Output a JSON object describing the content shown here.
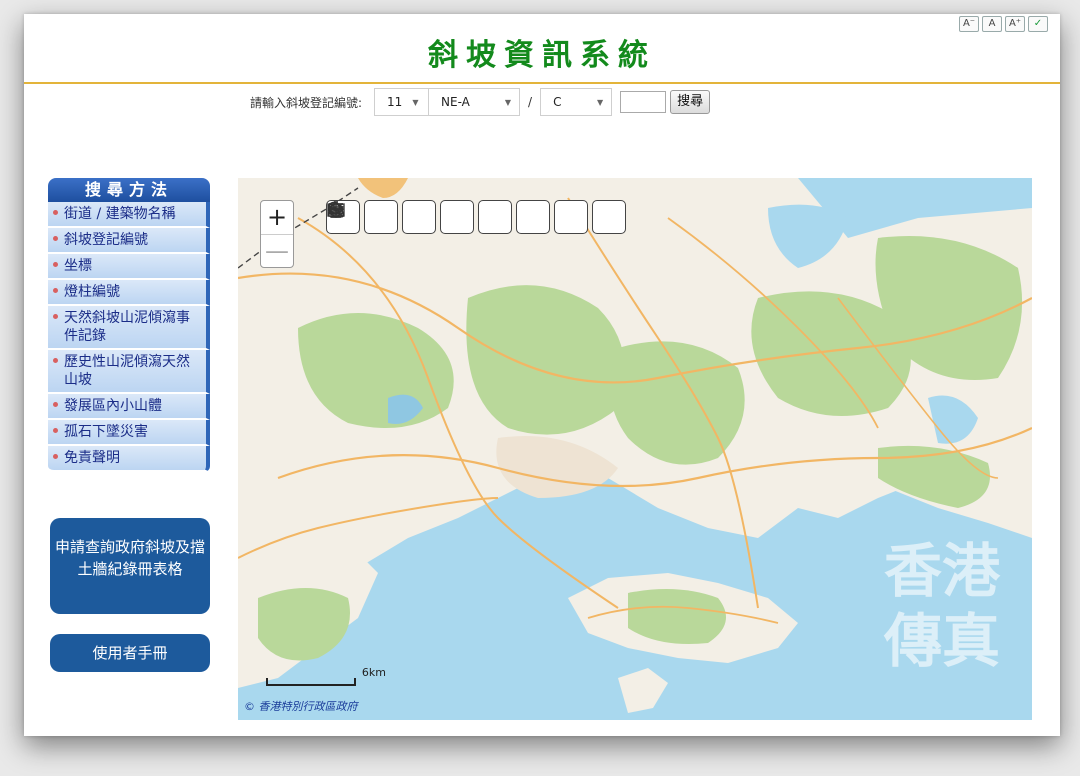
{
  "header": {
    "title": "斜坡資訊系統",
    "font_controls": [
      "A⁻",
      "A",
      "A⁺",
      "✓"
    ]
  },
  "search": {
    "label": "請輸入斜坡登記編號:",
    "sheet_no": "11",
    "subsheet": "NE-A",
    "separator": "/",
    "category": "C",
    "number_value": "",
    "button": "搜尋"
  },
  "sidebar": {
    "heading": "搜尋方法",
    "items": [
      {
        "label": "街道 / 建築物名稱"
      },
      {
        "label": "斜坡登記編號"
      },
      {
        "label": "坐標"
      },
      {
        "label": "燈柱編號"
      },
      {
        "label": "天然斜坡山泥傾瀉事件記錄"
      },
      {
        "label": "歷史性山泥傾瀉天然山坡"
      },
      {
        "label": "發展區內小山體"
      },
      {
        "label": "孤石下墜災害"
      },
      {
        "label": "免責聲明"
      }
    ],
    "apply_button": "申請查詢政府斜坡及擋土牆紀錄冊表格",
    "manual_button": "使用者手冊"
  },
  "map": {
    "zoom_in": "+",
    "zoom_out": "—",
    "tools": [
      "home-icon",
      "trash-icon",
      "zoom-in-icon",
      "zoom-out-icon",
      "undo-icon",
      "redo-icon",
      "layers-icon",
      "book-icon"
    ],
    "scale_label": "6km",
    "copyright": "© 香港特別行政區政府",
    "watermark": "香港 傳真",
    "colors": {
      "sea": "#a9d8ee",
      "land": "#f3efe6",
      "vegetation": "#b9d89a",
      "road": "#f2b664"
    }
  }
}
